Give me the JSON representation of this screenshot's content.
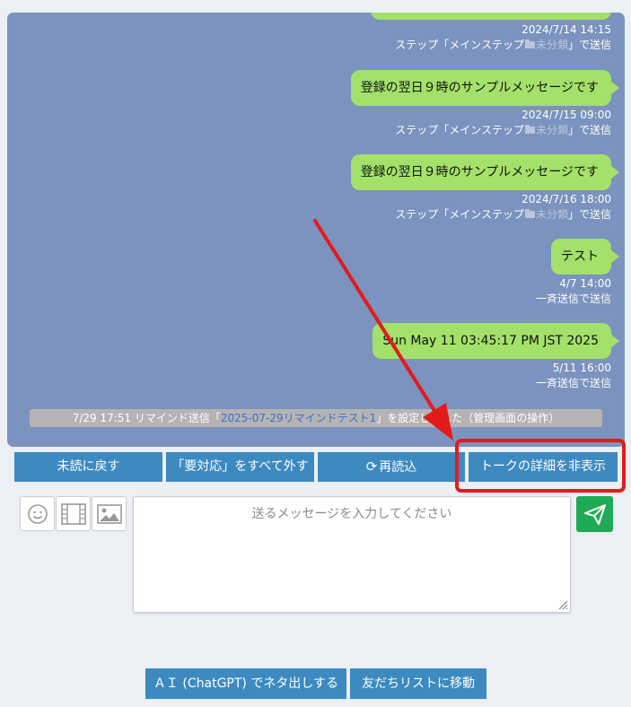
{
  "messages": [
    {
      "text": "",
      "date": "2024/7/14 14:15",
      "step_prefix": "ステップ「メインステップ",
      "folder": "未分類",
      "step_suffix": "」で送信"
    },
    {
      "text": "登録の翌日９時のサンプルメッセージです",
      "date": "2024/7/15 09:00",
      "step_prefix": "ステップ「メインステップ",
      "folder": "未分類",
      "step_suffix": "」で送信"
    },
    {
      "text": "登録の翌日９時のサンプルメッセージです",
      "date": "2024/7/16 18:00",
      "step_prefix": "ステップ「メインステップ",
      "folder": "未分類",
      "step_suffix": "」で送信"
    },
    {
      "text": "テスト",
      "date": "4/7 14:00",
      "sent_via": "一斉送信で送信"
    },
    {
      "text": "Sun May 11 03:45:17 PM JST 2025",
      "date": "5/11 16:00",
      "sent_via": "一斉送信で送信"
    }
  ],
  "system_notice": {
    "prefix": "7/29 17:51 リマインド送信「",
    "link": "2025-07-29リマインドテスト1",
    "suffix": "」を設定しました（管理画面の操作）"
  },
  "actions": {
    "unread": "未読に戻す",
    "clear_required": "「要対応」をすべて外す",
    "reload": "再読込",
    "reload_icon": "refresh-icon",
    "hide_details": "トークの詳細を非表示"
  },
  "tools": [
    "emoji-icon",
    "video-icon",
    "image-icon"
  ],
  "compose": {
    "placeholder": "送るメッセージを入力してください",
    "value": ""
  },
  "send_icon": "paper-plane-icon",
  "bottom": {
    "ai": "ＡＩ (ChatGPT) でネタ出しする",
    "friends": "友だちリストに移動"
  },
  "colors": {
    "chat_bg": "#7b93be",
    "bubble": "#a3e16a",
    "button": "#3d8ac1",
    "send": "#1faa55",
    "annotation": "#e31b1b"
  }
}
